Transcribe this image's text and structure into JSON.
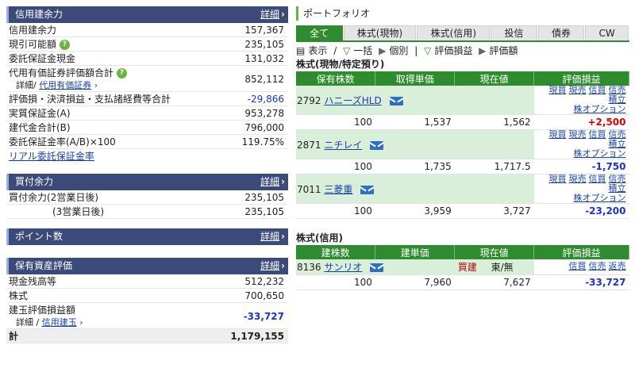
{
  "credit": {
    "title": "信用建余力",
    "detail": "詳細",
    "rows": [
      {
        "label": "信用建余力",
        "value": "157,367"
      },
      {
        "label": "現引可能額",
        "value": "235,105"
      },
      {
        "label": "委託保証金現金",
        "value": "131,032"
      },
      {
        "label": "代用有価証券評価額合計",
        "sub_prefix": "詳細/",
        "sub_link": "代用有価証券",
        "value": "852,112"
      },
      {
        "label": "評価損・決済損益・支払諸経費等合計",
        "value": "-29,866"
      },
      {
        "label": "実質保証金(A)",
        "value": "953,278"
      },
      {
        "label": "建代金合計(B)",
        "value": "796,000"
      },
      {
        "label": "委託保証金率(A/B)×100",
        "value": "119.75%"
      }
    ],
    "link": "リアル委託保証金率"
  },
  "buying": {
    "title": "買付余力",
    "detail": "詳細",
    "rows": [
      {
        "label": "買付余力(2営業日後)",
        "value": "235,105"
      },
      {
        "label": "(3営業日後)",
        "value": "235,105"
      }
    ]
  },
  "points": {
    "title": "ポイント数",
    "detail": "詳細"
  },
  "assets": {
    "title": "保有資産評価",
    "detail": "詳細",
    "rows": [
      {
        "label": "現金残高等",
        "value": "512,232"
      },
      {
        "label": "株式",
        "value": "700,650"
      },
      {
        "label": "建玉評価損益額",
        "sub_prefix": "詳細 /",
        "sub_link": "信用建玉",
        "value": "-33,727"
      }
    ],
    "total_label": "計",
    "total_value": "1,179,155"
  },
  "portfolio": {
    "title": "ポートフォリオ",
    "tabs": [
      "全て",
      "株式(現物)",
      "株式(信用)",
      "投信",
      "債券",
      "CW"
    ],
    "active_tab": "全て",
    "controls": {
      "display": "表示",
      "bulk": "一括",
      "individual": "個別",
      "eval": "評価損益",
      "eval_amount": "評価額"
    },
    "cash_section": {
      "title": "株式(現物/特定預り)",
      "headers": [
        "保有株数",
        "取得単価",
        "現在値",
        "評価損益"
      ],
      "stocks": [
        {
          "code": "2792",
          "name": "ハニーズHLD",
          "qty": "100",
          "cost": "1,537",
          "price": "1,562",
          "pl": "+2,500",
          "pl_sign": "pos"
        },
        {
          "code": "2871",
          "name": "ニチレイ",
          "qty": "100",
          "cost": "1,735",
          "price": "1,717.5",
          "pl": "-1,750",
          "pl_sign": "neg"
        },
        {
          "code": "7011",
          "name": "三菱重",
          "qty": "100",
          "cost": "3,959",
          "price": "3,727",
          "pl": "-23,200",
          "pl_sign": "neg"
        }
      ],
      "actions_line1": [
        "現買",
        "現売",
        "信買",
        "信売",
        "積立"
      ],
      "actions_line2": "株オプション"
    },
    "margin_section": {
      "title": "株式(信用)",
      "headers": [
        "建株数",
        "建単価",
        "現在値",
        "評価損益"
      ],
      "stocks": [
        {
          "code": "8136",
          "name": "サンリオ",
          "side": "買建",
          "market": "東/無",
          "qty": "100",
          "cost": "7,960",
          "price": "7,627",
          "pl": "-33,727"
        }
      ],
      "actions": [
        "信買",
        "信売",
        "返売"
      ]
    }
  }
}
